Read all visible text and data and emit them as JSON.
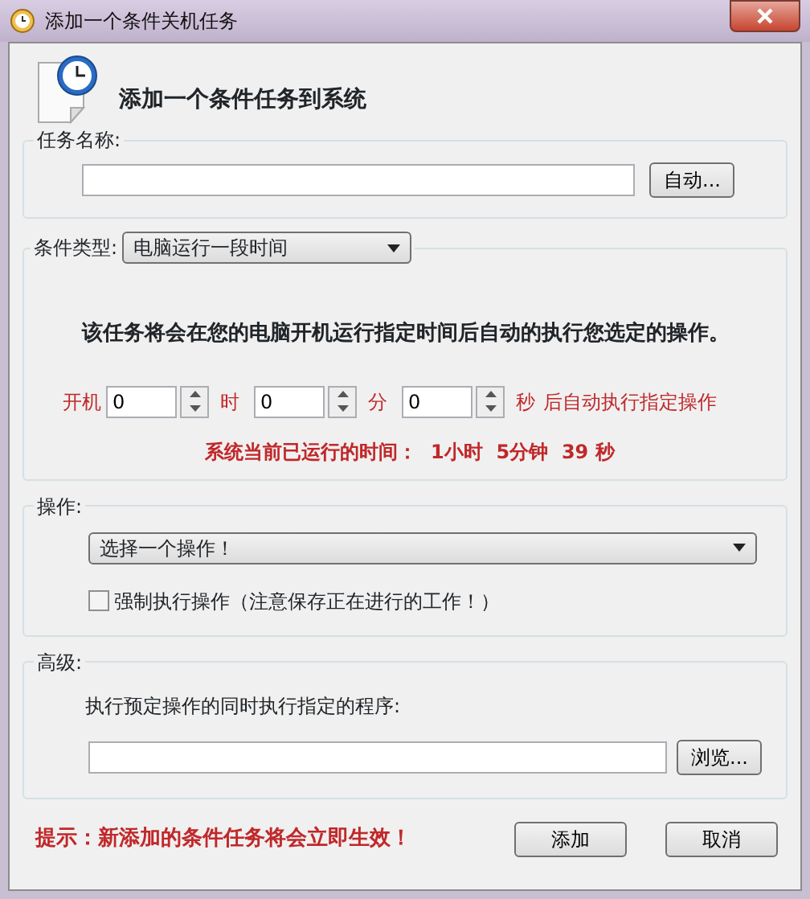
{
  "window": {
    "title": "添加一个条件关机任务"
  },
  "header": {
    "title": "添加一个条件任务到系统"
  },
  "task_name": {
    "label": "任务名称:",
    "button": "自动..."
  },
  "condition": {
    "label": "条件类型:",
    "type_value": "电脑运行一段时间",
    "description": "该任务将会在您的电脑开机运行指定时间后自动的执行您选定的操作。",
    "lead": "开机",
    "fields": [
      {
        "value": "0",
        "unit": "时"
      },
      {
        "value": "0",
        "unit": "分"
      },
      {
        "value": "0",
        "unit": "秒"
      }
    ],
    "trail": "后自动执行指定操作",
    "uptime": "系统当前已运行的时间：  1小时  5分钟  39 秒"
  },
  "operation": {
    "label": "操作:",
    "select_value": "选择一个操作！",
    "force": {
      "label": "强制执行操作（注意保存正在进行的工作！）",
      "checked": false
    }
  },
  "advanced": {
    "label": "高级:",
    "prompt": "执行预定操作的同时执行指定的程序:",
    "button": "浏览..."
  },
  "footer": {
    "tip": "提示：新添加的条件任务将会立即生效！",
    "buttons": [
      "添加",
      "取消"
    ]
  }
}
